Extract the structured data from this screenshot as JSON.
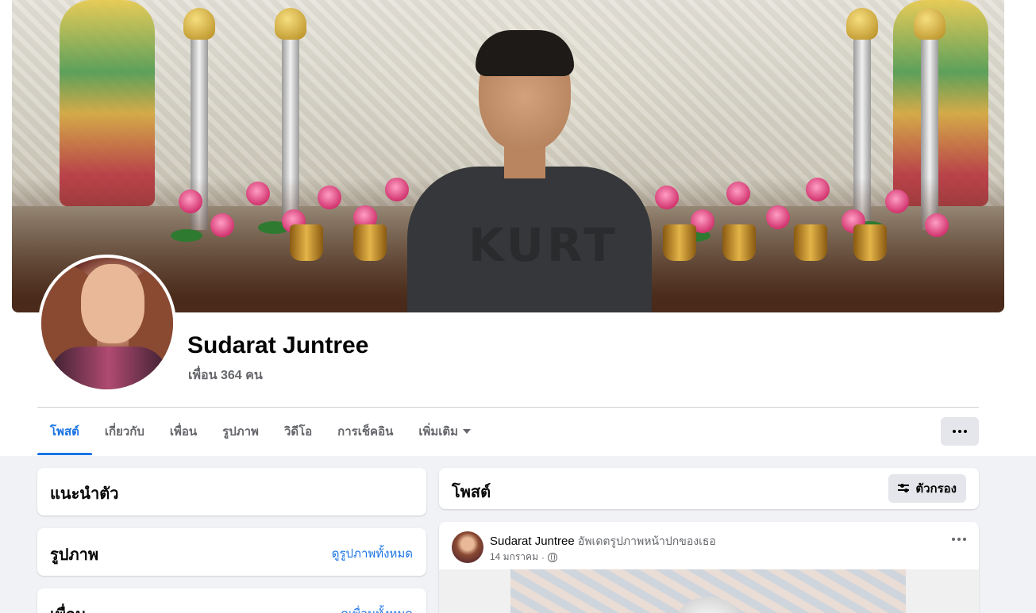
{
  "profile": {
    "name": "Sudarat Juntree",
    "friends_count": "เพื่อน 364 คน"
  },
  "tabs": [
    {
      "label": "โพสต์",
      "active": true
    },
    {
      "label": "เกี่ยวกับ"
    },
    {
      "label": "เพื่อน"
    },
    {
      "label": "รูปภาพ"
    },
    {
      "label": "วิดีโอ"
    },
    {
      "label": "การเช็คอิน"
    },
    {
      "label": "เพิ่มเติม"
    }
  ],
  "intro": {
    "title": "แนะนำตัว"
  },
  "photos": {
    "title": "รูปภาพ",
    "link": "ดูรูปภาพทั้งหมด"
  },
  "friends": {
    "title": "เพื่อน",
    "link": "ดูเพื่อนทั้งหมด"
  },
  "posts": {
    "title": "โพสต์",
    "filter_label": "ตัวกรอง"
  },
  "post": {
    "author": "Sudarat Juntree",
    "action": "อัพเดตรูปภาพหน้าปกของเธอ",
    "date": "14 มกราคม",
    "separator": "·"
  },
  "cover_shirt_text": "KURT",
  "colors": {
    "accent": "#1b74e4",
    "secondary_text": "#65676b",
    "feed_background": "#f0f2f5",
    "button_grey": "#e4e6eb"
  },
  "icons": {
    "more": "more-dots-icon",
    "filter": "filter-sliders-icon",
    "privacy": "globe-icon",
    "dropdown": "caret-down-icon"
  }
}
